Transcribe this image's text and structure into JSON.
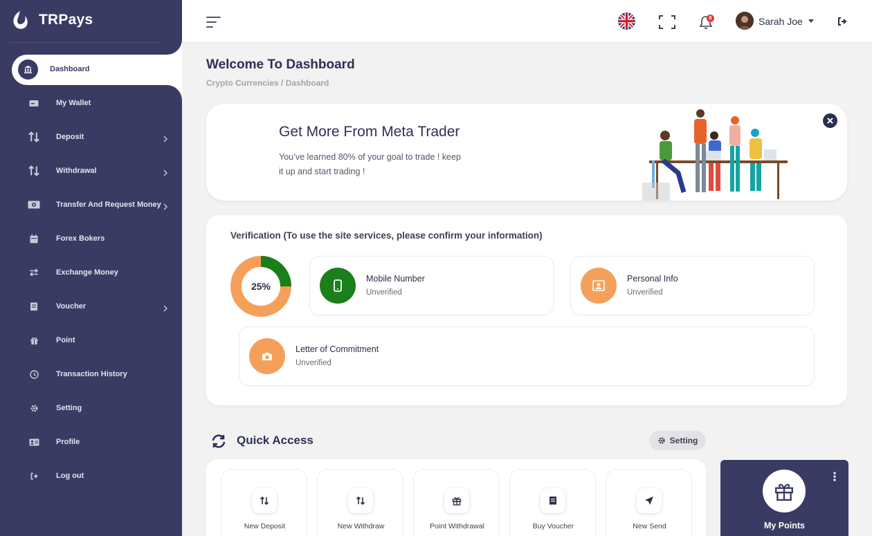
{
  "brand": {
    "name": "TRPays"
  },
  "sidebar": {
    "active": {
      "label": "Dashboard",
      "icon": "bank-icon"
    },
    "items": [
      {
        "label": "My Wallet",
        "icon": "wallet-icon",
        "has_submenu": false
      },
      {
        "label": "Deposit",
        "icon": "arrows-up-down-icon",
        "has_submenu": true
      },
      {
        "label": "Withdrawal",
        "icon": "arrows-up-down-icon",
        "has_submenu": true
      },
      {
        "label": "Transfer And Request Money",
        "icon": "money-bill-icon",
        "has_submenu": true
      },
      {
        "label": "Forex Bokers",
        "icon": "calendar-icon",
        "has_submenu": false
      },
      {
        "label": "Exchange Money",
        "icon": "exchange-icon",
        "has_submenu": false
      },
      {
        "label": "Voucher",
        "icon": "receipt-icon",
        "has_submenu": true
      },
      {
        "label": "Point",
        "icon": "gift-icon",
        "has_submenu": false
      },
      {
        "label": "Transaction History",
        "icon": "clock-icon",
        "has_submenu": false
      },
      {
        "label": "Setting",
        "icon": "gear-icon",
        "has_submenu": false
      },
      {
        "label": "Profile",
        "icon": "id-card-icon",
        "has_submenu": false
      },
      {
        "label": "Log out",
        "icon": "logout-icon",
        "has_submenu": false
      }
    ]
  },
  "topbar": {
    "user_name": "Sarah Joe",
    "notification_count": "8",
    "language": "English (UK)"
  },
  "page": {
    "title": "Welcome To Dashboard",
    "breadcrumb": "Crypto Currencies / Dashboard"
  },
  "promo": {
    "title": "Get More From Meta Trader",
    "text": "You’ve learned 80% of your goal to trade ! keep it up and start trading !"
  },
  "verification": {
    "title": "Verification (To use the site services, please confirm your information)",
    "progress_label": "25%",
    "progress": 0.25,
    "items": [
      {
        "name": "Mobile Number",
        "status": "Unverified",
        "color": "#1b7f1b",
        "icon": "mobile-icon"
      },
      {
        "name": "Personal Info",
        "status": "Unverified",
        "color": "#f5a05a",
        "icon": "portrait-icon"
      },
      {
        "name": "Letter of Commitment",
        "status": "Unverified",
        "color": "#f5a05a",
        "icon": "camera-icon"
      }
    ]
  },
  "quick_access": {
    "title": "Quick Access",
    "setting_label": "Setting",
    "items": [
      {
        "label": "New Deposit",
        "icon": "arrows-up-down-icon"
      },
      {
        "label": "New Withdraw",
        "icon": "arrows-up-down-icon"
      },
      {
        "label": "Point Withdrawal",
        "icon": "gift-icon"
      },
      {
        "label": "Buy Voucher",
        "icon": "receipt-icon"
      },
      {
        "label": "New Send",
        "icon": "send-icon"
      }
    ]
  },
  "points": {
    "label": "My Points"
  },
  "colors": {
    "sidebar": "#393b63",
    "accent_green": "#1b7f1b",
    "accent_orange": "#f5a05a",
    "page_bg": "#f2f2f3"
  }
}
